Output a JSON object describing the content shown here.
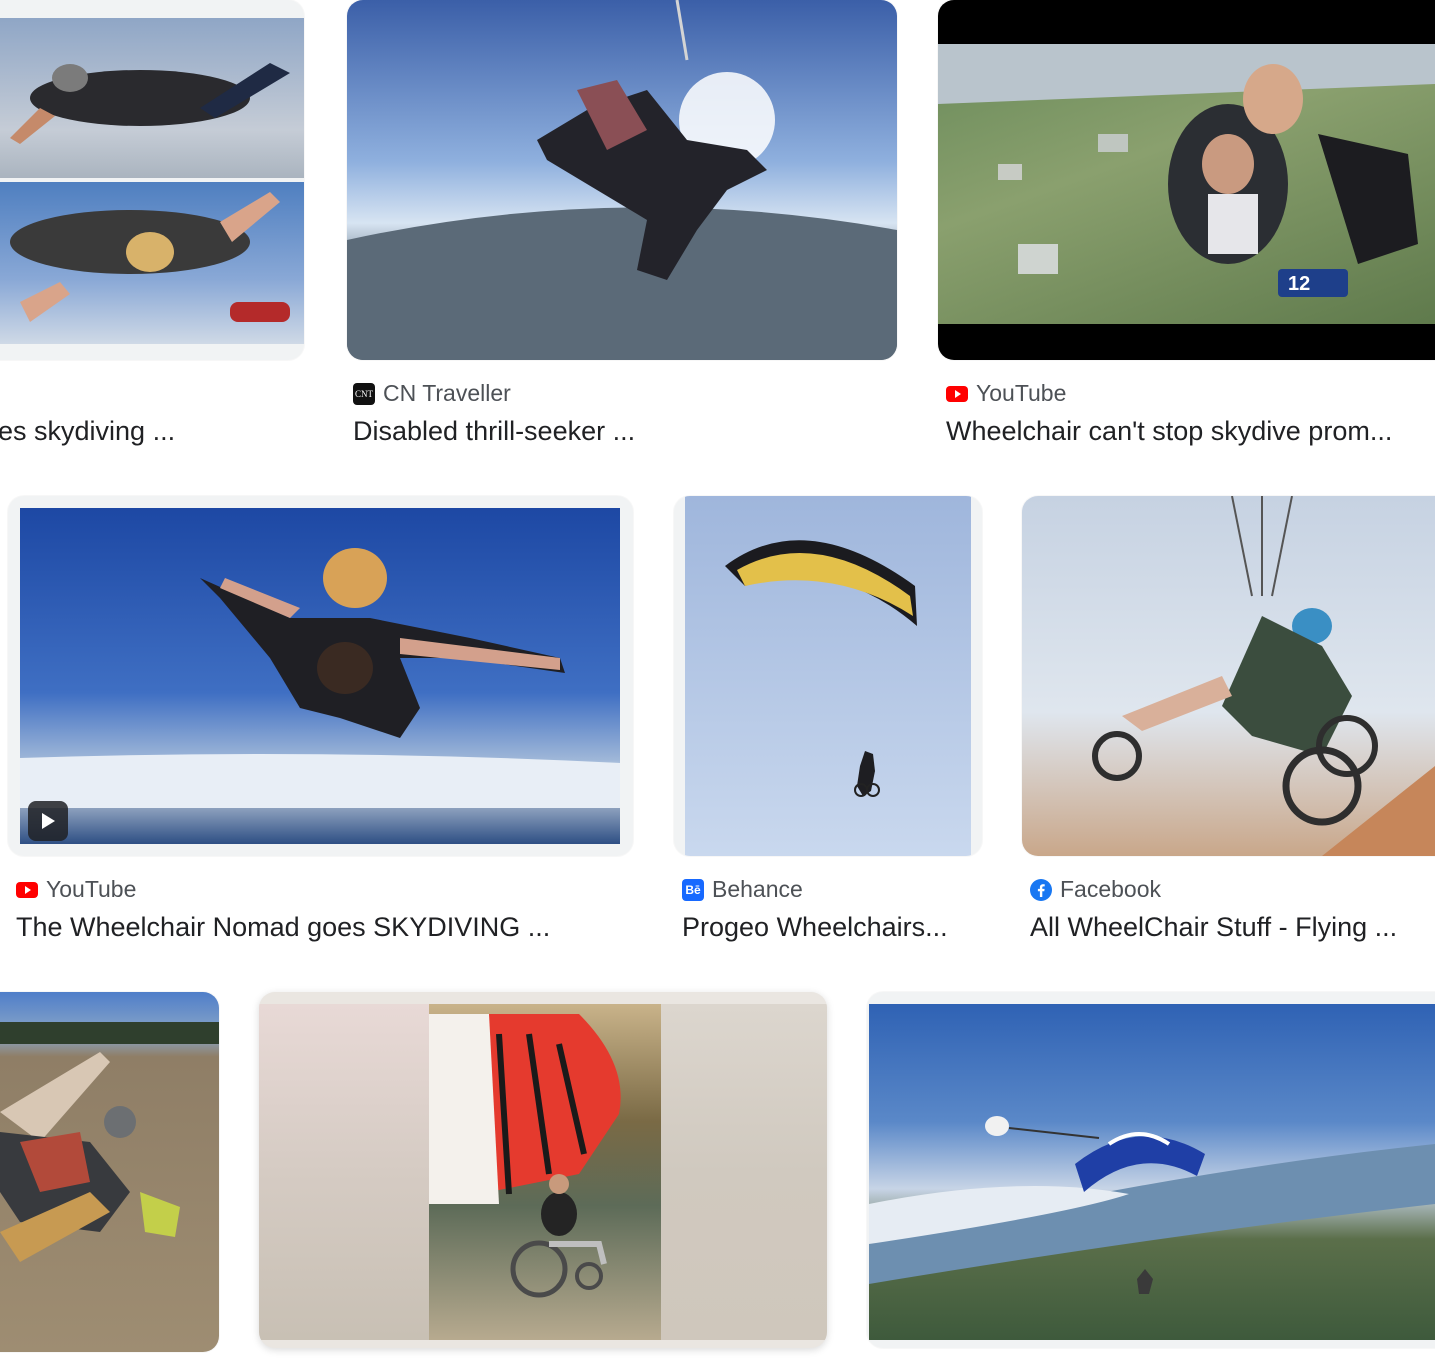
{
  "results": [
    {
      "title": "es skydiving ...",
      "source": ""
    },
    {
      "title": "Disabled thrill-seeker ...",
      "source": "CN Traveller"
    },
    {
      "title": "Wheelchair can't stop skydive prom...",
      "source": "YouTube"
    },
    {
      "title": "The Wheelchair Nomad goes SKYDIVING ...",
      "source": "YouTube"
    },
    {
      "title": "Progeo Wheelchairs...",
      "source": "Behance"
    },
    {
      "title": "All WheelChair Stuff - Flying ...",
      "source": "Facebook"
    },
    {
      "title": "",
      "source": ""
    },
    {
      "title": "",
      "source": ""
    },
    {
      "title": "",
      "source": ""
    }
  ],
  "favicons": {
    "cn_traveller": "CNT",
    "behance": "Bē"
  },
  "icons": {
    "play": "play-icon",
    "youtube": "youtube-icon",
    "facebook": "facebook-icon"
  },
  "colors": {
    "youtube_red": "#ff0000",
    "facebook_blue": "#1877f2",
    "behance_blue": "#1769ff",
    "title_text": "#202124",
    "source_text": "#4d5156"
  }
}
